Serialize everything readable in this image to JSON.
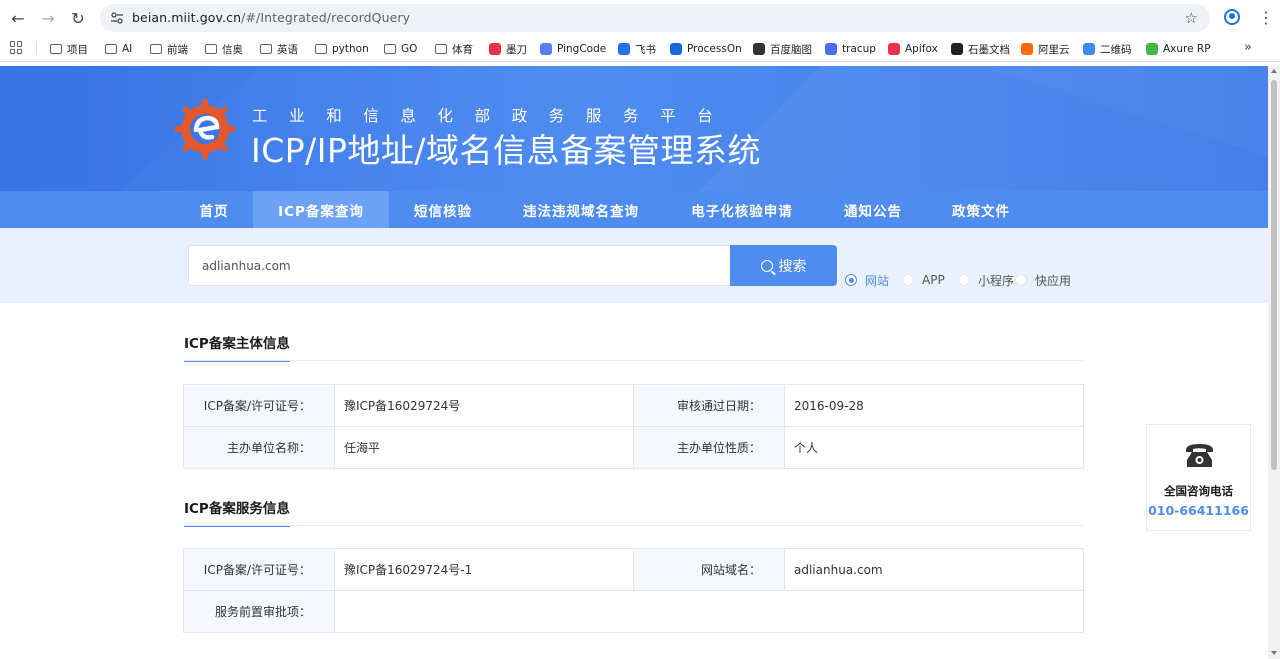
{
  "browser": {
    "url_host": "beian.miit.gov.cn",
    "url_path": "/#/Integrated/recordQuery",
    "bookmarks": [
      {
        "label": "项目",
        "icon": "folder-icon"
      },
      {
        "label": "AI",
        "icon": "folder-icon"
      },
      {
        "label": "前端",
        "icon": "folder-icon"
      },
      {
        "label": "信奥",
        "icon": "folder-icon"
      },
      {
        "label": "英语",
        "icon": "folder-icon"
      },
      {
        "label": "python",
        "icon": "folder-icon"
      },
      {
        "label": "GO",
        "icon": "folder-icon"
      },
      {
        "label": "体育",
        "icon": "folder-icon"
      },
      {
        "label": "墨刀",
        "icon": "modao-icon",
        "color": "#e8334a"
      },
      {
        "label": "PingCode",
        "icon": "pingcode-icon",
        "color": "#5b7cf7"
      },
      {
        "label": "飞书",
        "icon": "feishu-icon",
        "color": "#2a6df5"
      },
      {
        "label": "ProcessOn",
        "icon": "processon-icon",
        "color": "#1668dc"
      },
      {
        "label": "百度脑图",
        "icon": "baidu-naotu-icon",
        "color": "#333333"
      },
      {
        "label": "tracup",
        "icon": "tracup-icon",
        "color": "#4c6ef5"
      },
      {
        "label": "Apifox",
        "icon": "apifox-icon",
        "color": "#e8334a"
      },
      {
        "label": "石墨文档",
        "icon": "shimo-icon",
        "color": "#222222"
      },
      {
        "label": "阿里云",
        "icon": "aliyun-icon",
        "color": "#ff6a00"
      },
      {
        "label": "二维码",
        "icon": "qrcode-icon",
        "color": "#3d8af7"
      },
      {
        "label": "Axure RP",
        "icon": "axure-icon",
        "color": "#46b34b"
      }
    ]
  },
  "header": {
    "subtitle": "工业和信息化部政务服务平台",
    "title": "ICP/IP地址/域名信息备案管理系统"
  },
  "nav": {
    "items": [
      {
        "label": "首页",
        "active": false
      },
      {
        "label": "ICP备案查询",
        "active": true
      },
      {
        "label": "短信核验",
        "active": false
      },
      {
        "label": "违法违规域名查询",
        "active": false
      },
      {
        "label": "电子化核验申请",
        "active": false
      },
      {
        "label": "通知公告",
        "active": false
      },
      {
        "label": "政策文件",
        "active": false
      }
    ]
  },
  "search": {
    "value": "adlianhua.com",
    "button_label": "搜索",
    "types": [
      {
        "label": "网站",
        "checked": true
      },
      {
        "label": "APP",
        "checked": false
      },
      {
        "label": "小程序",
        "checked": false
      },
      {
        "label": "快应用",
        "checked": false
      }
    ]
  },
  "subject_info": {
    "title": "ICP备案主体信息",
    "rows": [
      {
        "label1": "ICP备案/许可证号：",
        "value1": "豫ICP备16029724号",
        "label2": "审核通过日期：",
        "value2": "2016-09-28"
      },
      {
        "label1": "主办单位名称：",
        "value1": "任海平",
        "label2": "主办单位性质：",
        "value2": "个人"
      }
    ]
  },
  "service_info": {
    "title": "ICP备案服务信息",
    "row1": {
      "label1": "ICP备案/许可证号：",
      "value1": "豫ICP备16029724号-1",
      "label2": "网站域名：",
      "value2": "adlianhua.com"
    },
    "row2": {
      "label": "服务前置审批项：",
      "value": ""
    }
  },
  "hotline": {
    "label": "全国咨询电话",
    "number": "010-66411166"
  },
  "colors": {
    "primary": "#4e8cf0",
    "header": "#3b76e5",
    "nav_active": "#6ba2f6",
    "search_band": "#e8f1fd"
  }
}
